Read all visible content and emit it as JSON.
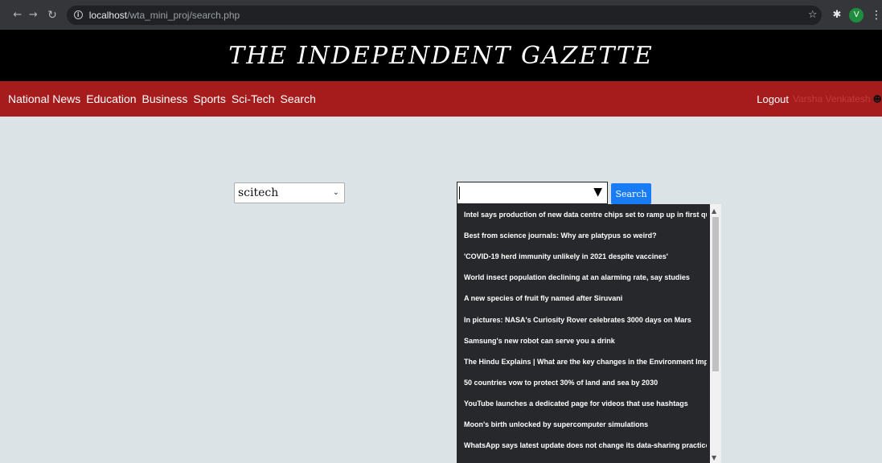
{
  "browser": {
    "url_host": "localhost",
    "url_path": "/wta_mini_proj/search.php",
    "profile_initial": "V"
  },
  "site": {
    "title": "THE INDEPENDENT GAZETTE"
  },
  "nav": {
    "items": [
      "National News",
      "Education",
      "Business",
      "Sports",
      "Sci-Tech",
      "Search"
    ],
    "logout": "Logout",
    "username": "Varsha Venkatesh"
  },
  "search": {
    "category_selected": "scitech",
    "button_label": "Search",
    "suggestions": [
      "Intel says production of new data centre chips set to ramp up in first quarter",
      "Best from science journals: Why are platypus so weird?",
      "'COVID-19 herd immunity unlikely in 2021 despite vaccines'",
      "World insect population declining at an alarming rate, say studies",
      "A new species of fruit fly named after Siruvani",
      "In pictures: NASA's Curiosity Rover celebrates 3000 days on Mars",
      "Samsung's new robot can serve you a drink",
      "The Hindu Explains | What are the key changes in the Environment Impact Assessment",
      "50 countries vow to protect 30% of land and sea by 2030",
      "YouTube launches a dedicated page for videos that use hashtags",
      "Moon's birth unlocked by supercomputer simulations",
      "WhatsApp says latest update does not change its data-sharing practices"
    ]
  },
  "colors": {
    "navbar": "#a61c1c",
    "masthead": "#000000",
    "page_bg": "#dce3e6",
    "search_button": "#1a7cf5",
    "dropdown_bg": "#27282b"
  }
}
